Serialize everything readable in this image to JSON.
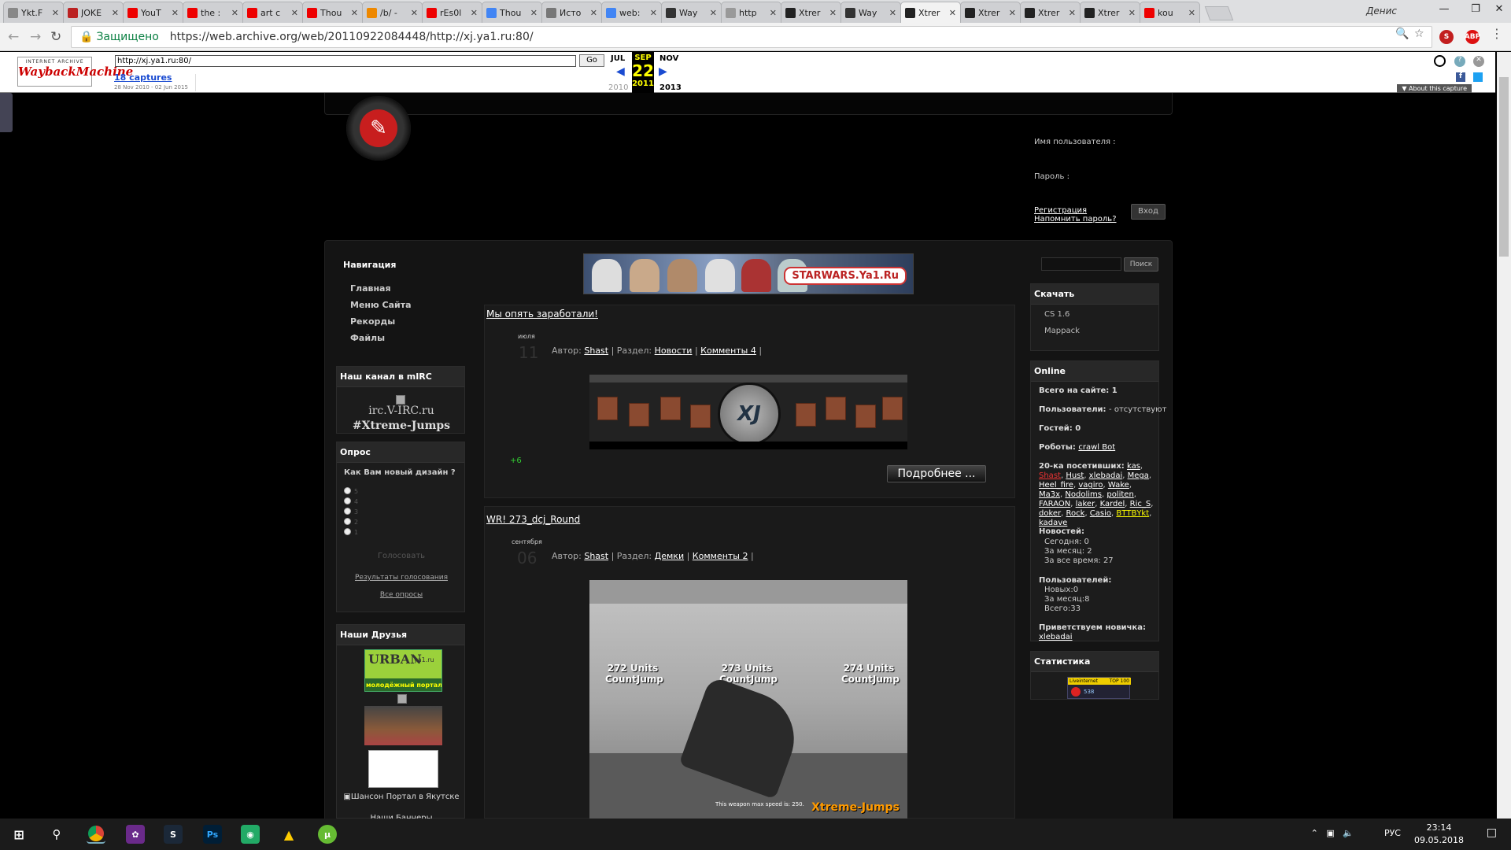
{
  "tabs": [
    {
      "label": "Ykt.F",
      "icon": "wiki-icon",
      "color": "#888"
    },
    {
      "label": "JOKE",
      "icon": "joke-icon",
      "color": "#b22"
    },
    {
      "label": "YouT",
      "icon": "youtube-icon",
      "color": "#e00"
    },
    {
      "label": "the :",
      "icon": "youtube-icon",
      "color": "#e00"
    },
    {
      "label": "art c",
      "icon": "youtube-icon",
      "color": "#e00"
    },
    {
      "label": "Thou",
      "icon": "youtube-icon",
      "color": "#e00"
    },
    {
      "label": "/b/ -",
      "icon": "bolt-icon",
      "color": "#e80"
    },
    {
      "label": "rEs0l",
      "icon": "youtube-icon",
      "color": "#e00"
    },
    {
      "label": "Thou",
      "icon": "google-icon",
      "color": "#4285f4"
    },
    {
      "label": "Исто",
      "icon": "history-icon",
      "color": "#777"
    },
    {
      "label": "web:",
      "icon": "google-icon",
      "color": "#4285f4"
    },
    {
      "label": "Way",
      "icon": "archive-icon",
      "color": "#333"
    },
    {
      "label": "http",
      "icon": "page-icon",
      "color": "#999"
    },
    {
      "label": "Xtrer",
      "icon": "xj-icon",
      "color": "#222"
    },
    {
      "label": "Way",
      "icon": "archive-icon",
      "color": "#333"
    },
    {
      "label": "Xtrer",
      "icon": "xj-icon",
      "color": "#222",
      "active": true
    },
    {
      "label": "Xtrer",
      "icon": "xj-icon",
      "color": "#222"
    },
    {
      "label": "Xtrer",
      "icon": "xj-icon",
      "color": "#222"
    },
    {
      "label": "Xtrer",
      "icon": "xj-icon",
      "color": "#222"
    },
    {
      "label": "kou",
      "icon": "youtube-icon",
      "color": "#e00"
    }
  ],
  "user_name": "Денис",
  "address": {
    "secure_label": "Защищено",
    "url": "https://web.archive.org/web/20110922084448/http://xj.ya1.ru:80/"
  },
  "wayback": {
    "logo_top": "INTERNET ARCHIVE",
    "logo_main": "WaybackMachine",
    "url_value": "http://xj.ya1.ru:80/",
    "go_label": "Go",
    "captures": "18 captures",
    "range": "28 Nov 2010 - 02 Jun 2015",
    "prev_month": "JUL",
    "cur_month": "SEP",
    "cur_day": "22",
    "cur_year": "2011",
    "next_month": "NOV",
    "prev_year": "2010",
    "next_year": "2013",
    "about": "About this capture"
  },
  "login": {
    "username_label": "Имя пользователя :",
    "password_label": "Пароль :",
    "register": "Регистрация",
    "remind": "Напомнить пароль?",
    "enter": "Вход"
  },
  "nav": {
    "title": "Навигация",
    "items": [
      "Главная",
      "Меню Сайта",
      "Рекорды",
      "Файлы"
    ]
  },
  "irc": {
    "title": "Наш канал в mIRC",
    "server": "irc.V-IRC.ru",
    "channel": "#Xtreme-Jumps"
  },
  "poll": {
    "title": "Опрос",
    "question": "Как Вам новый дизайн ?",
    "options": [
      "5",
      "4",
      "3",
      "2",
      "1"
    ],
    "vote": "Голосовать",
    "results": "Результаты голосования",
    "all": "Все опросы"
  },
  "friends": {
    "title": "Наши Друзья",
    "urban_top": "URBAN",
    "urban_dom": "ya1.ru",
    "urban_sub": "молодёжный портал",
    "shanson": "Шансон Портал в Якутске",
    "banners": "Наши Баннеры"
  },
  "banner_text": "STARWARS.Ya1.Ru",
  "posts": [
    {
      "title": "Мы опять заработали!",
      "month": "июля",
      "day": "11",
      "author_label": "Автор:",
      "author": "Shast",
      "section_label": "Раздел:",
      "section": "Новости",
      "comments": "Комменты 4",
      "rating": "+6",
      "more": "Подробнее ..."
    },
    {
      "title": "WR! 273_dcj_Round",
      "month": "сентября",
      "day": "06",
      "author_label": "Автор:",
      "author": "Shast",
      "section_label": "Раздел:",
      "section": "Демки",
      "comments": "Комменты 2"
    }
  ],
  "shot": {
    "label1": "272 Units CountJump",
    "label2": "273 Units CountJump",
    "label3": "274 Units CountJump",
    "brand": "Xtreme-Jumps",
    "note": "This weapon max speed is: 250."
  },
  "search_btn": "Поиск",
  "download": {
    "title": "Скачать",
    "items": [
      "CS 1.6",
      "Mappack"
    ]
  },
  "online": {
    "title": "Online",
    "total": "Всего на сайте: 1",
    "users_label": "Пользователи:",
    "users_value": "- отсутствуют",
    "guests": "Гостей: 0",
    "robots_label": "Роботы:",
    "robot": "crawl Bot",
    "top20_label": "20-ка посетивших:",
    "visitors": [
      "kas",
      "Shast",
      "Hust",
      "xlebadai",
      "Mega",
      "Heel_fire",
      "vagiro",
      "Wake",
      "Ma3x",
      "Nodolims",
      "politen",
      "FARAON",
      "laker",
      "Kardel",
      "Ric_S",
      "doker",
      "Rock",
      "Casio",
      "ВТТВYkt",
      "kadave"
    ],
    "news_label": "Новостей:",
    "news_today": "Сегодня: 0",
    "news_month": "За месяц: 2",
    "news_all": "За все время: 27",
    "users_stat_label": "Пользователей:",
    "new_users": "Новых:0",
    "month_users": "За месяц:8",
    "all_users": "Всего:33",
    "welcome_label": "Приветствуем новичка:",
    "newbie": "xlebadai"
  },
  "stats": {
    "title": "Статистика",
    "counter_site": "Liveinternet",
    "counter_top": "TOP 100",
    "counter_num": "538"
  },
  "taskbar": {
    "lang": "РУС",
    "time": "23:14",
    "date": "09.05.2018"
  }
}
